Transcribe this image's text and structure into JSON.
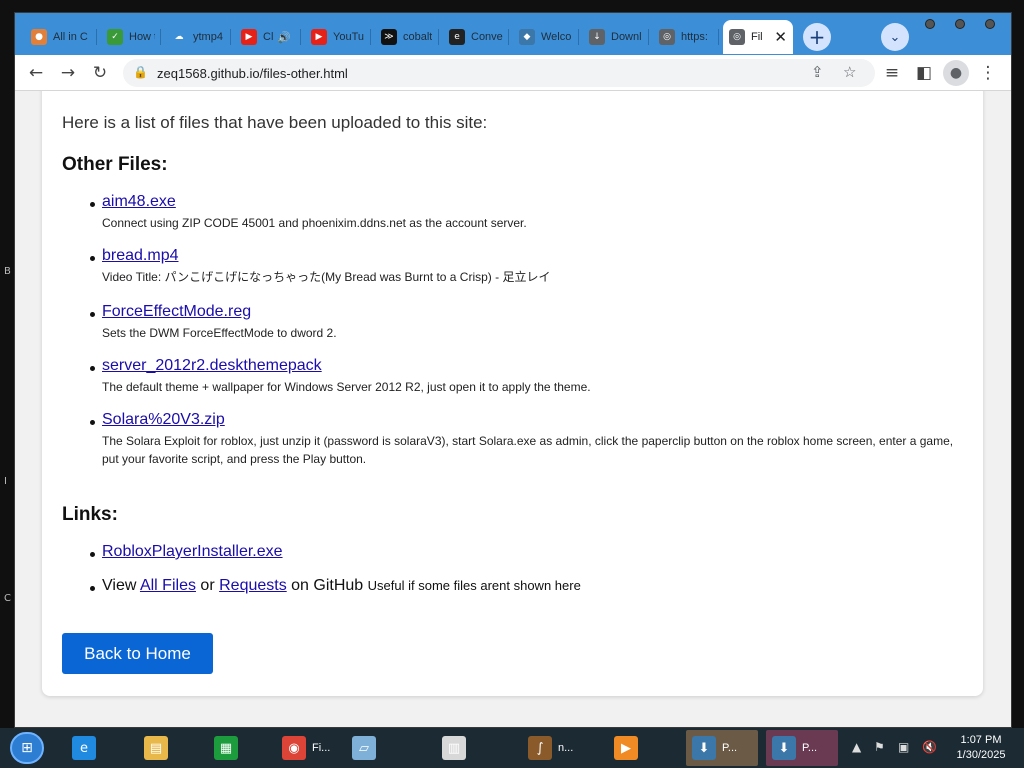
{
  "desktop": {
    "edge_letters": [
      "B",
      "I",
      "C"
    ]
  },
  "browser": {
    "tabs": [
      {
        "label": "All in C",
        "icon": "generic-orange-icon",
        "icon_color": "#e0803a"
      },
      {
        "label": "How t",
        "icon": "wikihow-icon",
        "icon_color": "#3a9a3a"
      },
      {
        "label": "ytmp4",
        "icon": "cloud-download-icon",
        "icon_color": "#3c8fd6"
      },
      {
        "label": "Cl",
        "icon": "youtube-icon",
        "icon_color": "#e62117",
        "audio": "🔊"
      },
      {
        "label": "YouTu",
        "icon": "youtube-shorts-icon",
        "icon_color": "#e62117"
      },
      {
        "label": "cobalt",
        "icon": "cobalt-icon",
        "icon_color": "#111111"
      },
      {
        "label": "Conve",
        "icon": "ez-converter-icon",
        "icon_color": "#222222"
      },
      {
        "label": "Welco",
        "icon": "python-icon",
        "icon_color": "#3b77a8"
      },
      {
        "label": "Downl",
        "icon": "download-icon",
        "icon_color": "#5f6368"
      },
      {
        "label": "https:",
        "icon": "globe-icon",
        "icon_color": "#5f6368"
      },
      {
        "label": "Fil",
        "icon": "globe-icon",
        "icon_color": "#5f6368",
        "active": true
      }
    ],
    "new_tab_symbol": "+",
    "tab_search_symbol": "⌄",
    "url": "zeq1568.github.io/files-other.html"
  },
  "page": {
    "intro": "Here is a list of files that have been uploaded to this site:",
    "other_files_heading": "Other Files:",
    "files": [
      {
        "name": "aim48.exe",
        "description": "Connect using ZIP CODE 45001 and phoenixim.ddns.net as the account server."
      },
      {
        "name": "bread.mp4",
        "description": "Video Title: パンこげこげになっちゃった(My Bread was Burnt to a Crisp) - 足立レイ"
      },
      {
        "name": "ForceEffectMode.reg",
        "description": "Sets the DWM ForceEffectMode to dword 2."
      },
      {
        "name": "server_2012r2.deskthemepack",
        "description": "The default theme + wallpaper for Windows Server 2012 R2, just open it to apply the theme."
      },
      {
        "name": "Solara%20V3.zip",
        "description": "The Solara Exploit for roblox, just unzip it (password is solaraV3), start Solara.exe as admin, click the paperclip button on the roblox home screen, enter a game, put your favorite script, and press the Play button."
      }
    ],
    "links_heading": "Links:",
    "links": {
      "installer": "RobloxPlayerInstaller.exe",
      "view_prefix": "View",
      "all_files": "All Files",
      "or_text": "or",
      "requests": "Requests",
      "on_github": "on GitHub",
      "note": "Useful if some files arent shown here"
    },
    "back_button": "Back to Home"
  },
  "taskbar": {
    "apps": [
      {
        "label": "",
        "icon": "internet-explorer-icon",
        "icon_color": "#1f8ae0"
      },
      {
        "label": "",
        "icon": "file-explorer-icon",
        "icon_color": "#e8b84a"
      },
      {
        "label": "",
        "icon": "store-icon",
        "icon_color": "#1c9c3c"
      },
      {
        "label": "Fi...",
        "icon": "chrome-icon",
        "icon_color": "#db4437"
      },
      {
        "label": "",
        "icon": "notepad-icon",
        "icon_color": "#7fb0d8"
      },
      {
        "label": "",
        "icon": "registry-icon",
        "icon_color": "#d8d8d8"
      },
      {
        "label": "n...",
        "icon": "paint-icon",
        "icon_color": "#8a5a2a"
      },
      {
        "label": "",
        "icon": "media-player-icon",
        "icon_color": "#f08a24"
      },
      {
        "label": "P...",
        "icon": "installer-icon",
        "icon_color": "#3b77a8"
      },
      {
        "label": "P...",
        "icon": "installer-icon",
        "icon_color": "#3b77a8"
      }
    ],
    "tray": {
      "chevron": "▲",
      "flag": "⚑",
      "network": "▣",
      "volume": "🔇"
    },
    "clock_time": "1:07 PM",
    "clock_date": "1/30/2025"
  }
}
